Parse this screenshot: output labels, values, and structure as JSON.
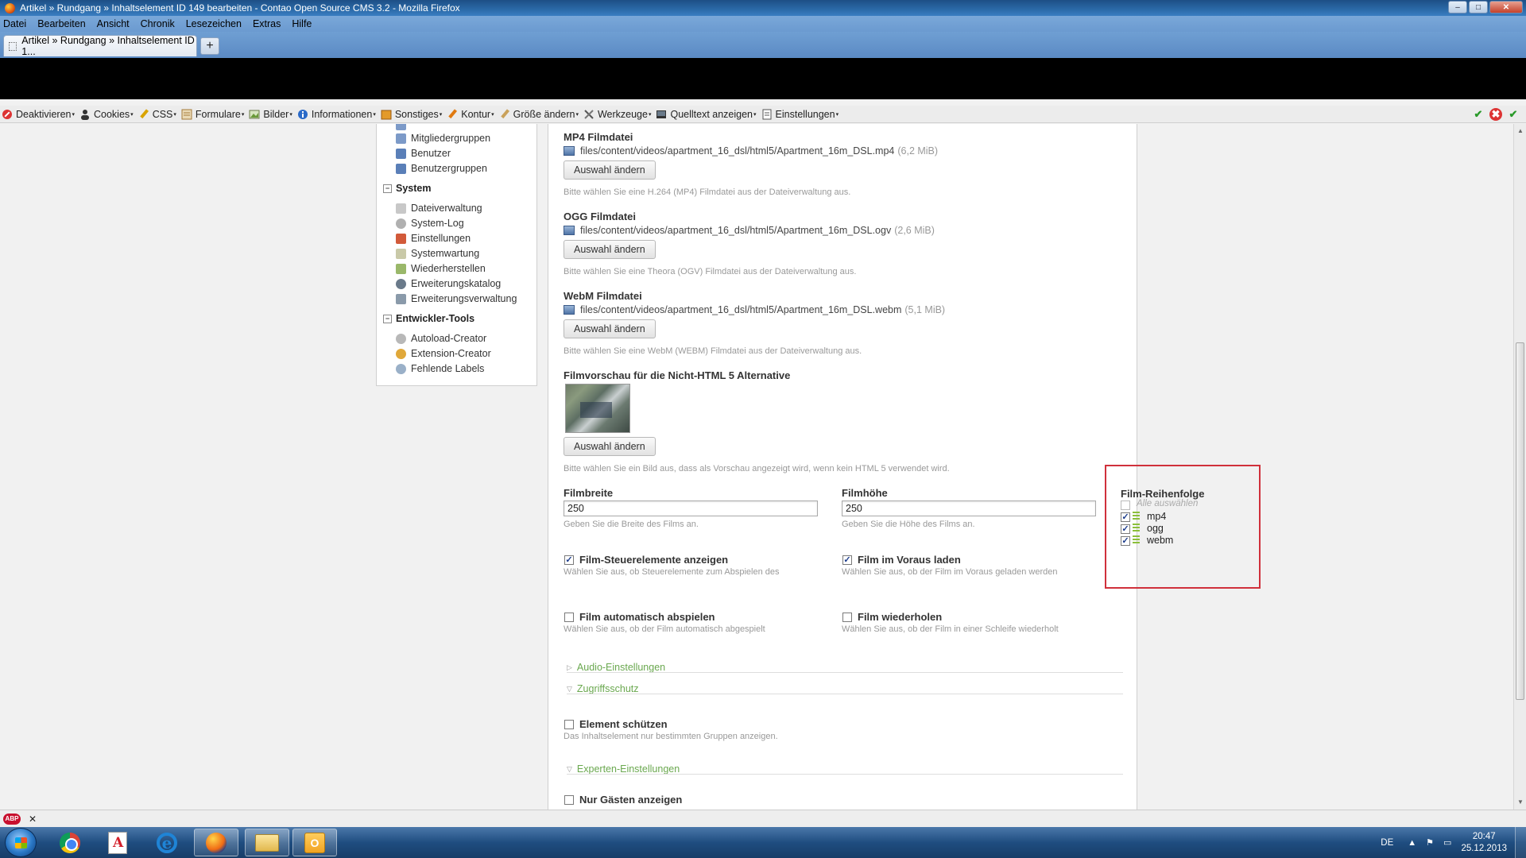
{
  "window": {
    "title": "Artikel » Rundgang » Inhaltselement ID 149 bearbeiten - Contao Open Source CMS 3.2 - Mozilla Firefox",
    "minimize": "–",
    "maximize": "□",
    "close": "✕"
  },
  "menubar": [
    "Datei",
    "Bearbeiten",
    "Ansicht",
    "Chronik",
    "Lesezeichen",
    "Extras",
    "Hilfe"
  ],
  "tab": {
    "label": "Artikel » Rundgang » Inhaltselement ID 1...",
    "new_tab": "+"
  },
  "webdev_toolbar": {
    "items": [
      {
        "label": "Deaktivieren",
        "icon": "disable-icon",
        "color": "#d33"
      },
      {
        "label": "Cookies",
        "icon": "cookie-user-icon",
        "color": "#333"
      },
      {
        "label": "CSS",
        "icon": "pencil-icon",
        "color": "#c90"
      },
      {
        "label": "Formulare",
        "icon": "form-icon",
        "color": "#b77"
      },
      {
        "label": "Bilder",
        "icon": "image-icon",
        "color": "#7a7"
      },
      {
        "label": "Informationen",
        "icon": "info-icon",
        "color": "#2a6ac8"
      },
      {
        "label": "Sonstiges",
        "icon": "misc-icon",
        "color": "#d80"
      },
      {
        "label": "Kontur",
        "icon": "outline-pencil-icon",
        "color": "#c60"
      },
      {
        "label": "Größe ändern",
        "icon": "resize-pencil-icon",
        "color": "#c60"
      },
      {
        "label": "Werkzeuge",
        "icon": "tools-icon",
        "color": "#555"
      },
      {
        "label": "Quelltext anzeigen",
        "icon": "source-icon",
        "color": "#333"
      },
      {
        "label": "Einstellungen",
        "icon": "settings-icon",
        "color": "#555"
      }
    ],
    "caret": "▾",
    "right_icons": [
      "✔",
      "✖",
      "✔"
    ]
  },
  "nav": {
    "items_top": [
      "Mitgliedergruppen",
      "Benutzer",
      "Benutzergruppen"
    ],
    "group_system": "System",
    "system_items": [
      "Dateiverwaltung",
      "System-Log",
      "Einstellungen",
      "Systemwartung",
      "Wiederherstellen",
      "Erweiterungskatalog",
      "Erweiterungsverwaltung"
    ],
    "group_dev": "Entwickler-Tools",
    "dev_items": [
      "Autoload-Creator",
      "Extension-Creator",
      "Fehlende Labels"
    ],
    "collapse_symbol": "−"
  },
  "form": {
    "mp4": {
      "label": "MP4 Filmdatei",
      "file": "files/content/videos/apartment_16_dsl/html5/Apartment_16m_DSL.mp4",
      "size": "(6,2 MiB)",
      "button": "Auswahl ändern",
      "help": "Bitte wählen Sie eine H.264 (MP4) Filmdatei aus der Dateiverwaltung aus."
    },
    "ogg": {
      "label": "OGG Filmdatei",
      "file": "files/content/videos/apartment_16_dsl/html5/Apartment_16m_DSL.ogv",
      "size": "(2,6 MiB)",
      "button": "Auswahl ändern",
      "help": "Bitte wählen Sie eine Theora (OGV) Filmdatei aus der Dateiverwaltung aus."
    },
    "webm": {
      "label": "WebM Filmdatei",
      "file": "files/content/videos/apartment_16_dsl/html5/Apartment_16m_DSL.webm",
      "size": "(5,1 MiB)",
      "button": "Auswahl ändern",
      "help": "Bitte wählen Sie eine WebM (WEBM) Filmdatei aus der Dateiverwaltung aus."
    },
    "preview": {
      "label": "Filmvorschau für die Nicht-HTML 5 Alternative",
      "button": "Auswahl ändern",
      "help": "Bitte wählen Sie ein Bild aus, dass als Vorschau angezeigt wird, wenn kein HTML 5 verwendet wird."
    },
    "width": {
      "label": "Filmbreite",
      "value": "250",
      "help": "Geben Sie die Breite des Films an."
    },
    "height": {
      "label": "Filmhöhe",
      "value": "250",
      "help": "Geben Sie die Höhe des Films an."
    },
    "order": {
      "label": "Film-Reihenfolge",
      "select_all": "Alle auswählen",
      "items": [
        {
          "label": "mp4",
          "checked": true
        },
        {
          "label": "ogg",
          "checked": true
        },
        {
          "label": "webm",
          "checked": true
        }
      ]
    },
    "controls": {
      "label": "Film-Steuerelemente anzeigen",
      "help": "Wählen Sie aus, ob Steuerelemente zum Abspielen des",
      "checked": true
    },
    "preload": {
      "label": "Film im Voraus laden",
      "help": "Wählen Sie aus, ob der Film im Voraus geladen werden",
      "checked": true
    },
    "autoplay": {
      "label": "Film automatisch abspielen",
      "help": "Wählen Sie aus, ob der Film automatisch abgespielt",
      "checked": false
    },
    "loop": {
      "label": "Film wiederholen",
      "help": "Wählen Sie aus, ob der Film in einer Schleife wiederholt",
      "checked": false
    },
    "legend_audio": "Audio-Einstellungen",
    "legend_access": "Zugriffsschutz",
    "protect": {
      "label": "Element schützen",
      "help": "Das Inhaltselement nur bestimmten Gruppen anzeigen.",
      "checked": false
    },
    "legend_expert": "Experten-Einstellungen",
    "guests": {
      "label": "Nur Gästen anzeigen",
      "checked": false
    }
  },
  "statusbar": {
    "abp": "ABP",
    "close": "✕"
  },
  "taskbar": {
    "lang": "DE",
    "tray_up": "▲",
    "time": "20:47",
    "date": "25.12.2013"
  },
  "colors": {
    "highlight_border": "#d0303b",
    "legend_green": "#6aa84f",
    "title_bar": "#2b6aa8"
  }
}
